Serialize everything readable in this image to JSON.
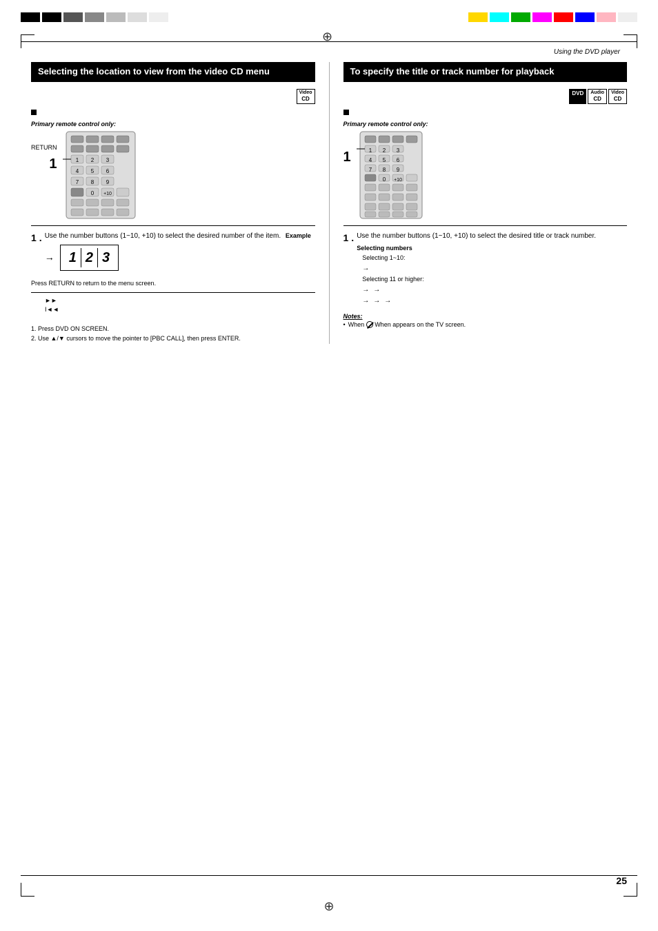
{
  "page": {
    "number": "25",
    "header": "Using the DVD player"
  },
  "left_section": {
    "title": "Selecting the location to view from the video CD menu",
    "disc_badge": "Video CD",
    "bullet_text": "",
    "remote_label": "Primary remote control only:",
    "return_label": "RETURN",
    "step1": {
      "number": "1",
      "dot": ".",
      "text": "Use the number buttons (1~10, +10) to select the desired number of the item.",
      "example_label": "Example",
      "arrow": "→",
      "numbers": [
        "1",
        "2",
        "3"
      ]
    },
    "press_note": "Press RETURN to return to the menu screen.",
    "sub_note1": "►► ",
    "sub_note2": "I◄◄",
    "bottom_note1": "1.  Press DVD ON SCREEN.",
    "bottom_note2": "2.  Use ▲/▼ cursors to move the pointer to [PBC CALL], then press ENTER."
  },
  "right_section": {
    "title": "To specify the title or track number for playback",
    "disc_badges": [
      {
        "type": "dvd",
        "label": "DVD"
      },
      {
        "type": "audio-cd",
        "label": "Audio CD"
      },
      {
        "type": "video-cd",
        "label": "Video CD"
      }
    ],
    "bullet_text": "",
    "remote_label": "Primary remote control only:",
    "step1": {
      "number": "1",
      "dot": ".",
      "text": "Use the number buttons (1~10, +10) to select the desired title or track number.",
      "selecting_numbers": "Selecting numbers",
      "selecting_1_10_label": "Selecting 1~10:",
      "selecting_11_label": "Selecting 11 or higher:",
      "arrow1": "→",
      "arrow2": "→",
      "arrow3": "→",
      "arrow4": "→",
      "arrow5": "→",
      "arrow6": "→"
    },
    "notes_title": "Notes:",
    "notes": [
      "When  appears on the TV screen."
    ]
  }
}
